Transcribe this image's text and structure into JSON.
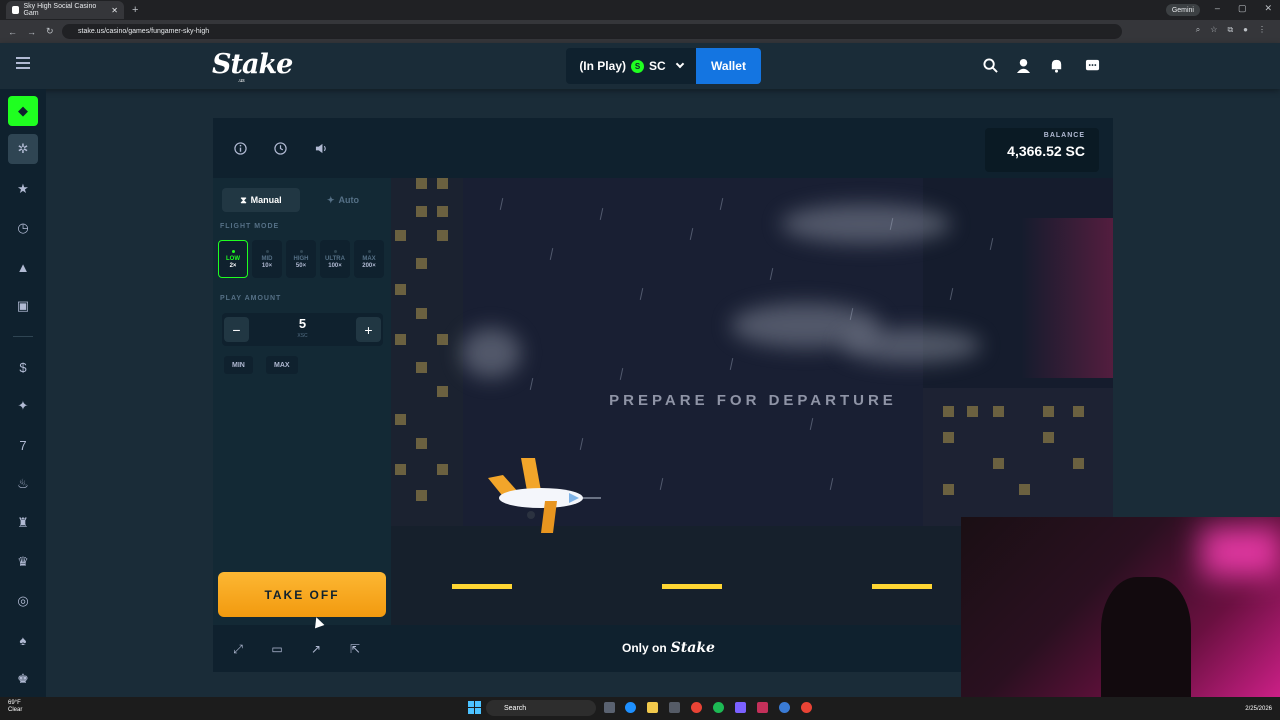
{
  "browser": {
    "tab_title": "Sky High Social Casino Gam",
    "url": "stake.us/casino/games/fungamer-sky-high",
    "gemini_label": "Gemini"
  },
  "header": {
    "logo": "Stake",
    "logo_sub": ".us",
    "in_play_label": "(In Play)",
    "currency": "SC",
    "wallet_label": "Wallet",
    "icons": [
      "search-icon",
      "user-icon",
      "bell-icon",
      "chat-icon"
    ]
  },
  "sidebar": {
    "icons": [
      "menu-icon",
      "stake-originals-icon",
      "casino-icon",
      "favourites-icon",
      "recent-icon",
      "challenges-icon",
      "my-bets-icon",
      "stake-exclusives-icon",
      "new-releases-icon",
      "slots-icon",
      "popular-icon",
      "table-games-icon",
      "live-casino-icon",
      "roulette-icon",
      "blackjack-icon"
    ]
  },
  "game": {
    "balance_label": "BALANCE",
    "balance_value": "4,366.52 SC",
    "tabs": {
      "manual": "Manual",
      "auto": "Auto"
    },
    "flight_mode_label": "FLIGHT MODE",
    "flight_modes": [
      {
        "name": "LOW",
        "mult": "2×"
      },
      {
        "name": "MID",
        "mult": "10×"
      },
      {
        "name": "HIGH",
        "mult": "50×"
      },
      {
        "name": "ULTRA",
        "mult": "100×"
      },
      {
        "name": "MAX",
        "mult": "200×"
      }
    ],
    "play_amount_label": "PLAY AMOUNT",
    "amount_value": "5",
    "amount_unit": "XSC",
    "min_label": "MIN",
    "max_label": "MAX",
    "takeoff_label": "TAKE OFF",
    "status_text": "PREPARE FOR DEPARTURE",
    "only_on_label": "Only on",
    "only_on_brand": "Stake"
  },
  "taskbar": {
    "weather_temp": "69°F",
    "weather_desc": "Clear",
    "search_label": "Search",
    "date": "2/25/2026"
  },
  "colors": {
    "accent_green": "#1fff20",
    "wallet_blue": "#1475e1",
    "takeoff_orange": "#fdb733",
    "runway_yellow": "#ffd633"
  }
}
